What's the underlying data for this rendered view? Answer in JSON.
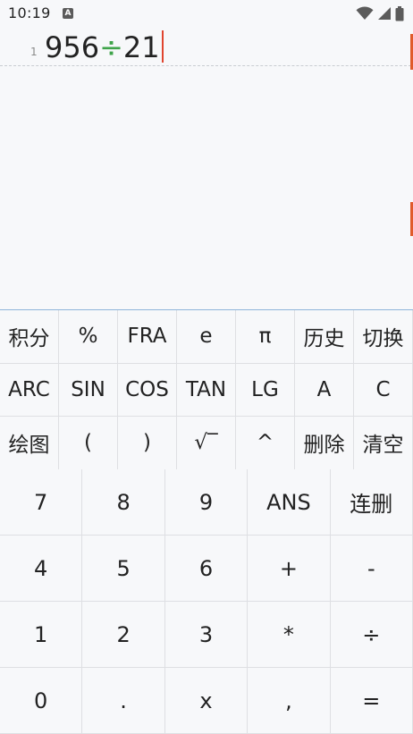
{
  "status_bar": {
    "time": "10:19",
    "notification_icon_letter": "A",
    "icons": [
      "wifi-icon",
      "cellular-signal-icon",
      "battery-icon"
    ]
  },
  "editor": {
    "line_number": "1",
    "expression": {
      "left": "956",
      "operator": "÷",
      "right": "21"
    },
    "cursor_color": "#e0452f",
    "operator_color": "#3fa44a"
  },
  "function_keys": [
    [
      "积分",
      "%",
      "FRA",
      "e",
      "π",
      "历史",
      "切换"
    ],
    [
      "ARC",
      "SIN",
      "COS",
      "TAN",
      "LG",
      "A",
      "C"
    ],
    [
      "绘图",
      "(",
      ")",
      "√‾",
      "^",
      "删除",
      "清空"
    ]
  ],
  "number_keys": [
    [
      "7",
      "8",
      "9",
      "ANS",
      "连删"
    ],
    [
      "4",
      "5",
      "6",
      "+",
      "-"
    ],
    [
      "1",
      "2",
      "3",
      "*",
      "÷"
    ],
    [
      "0",
      ".",
      "x",
      ",",
      "="
    ]
  ],
  "colors": {
    "background": "#f7f8fa",
    "divider": "#dedfe3",
    "keypad_top_border": "#8fb4d9",
    "edge_accent": "#e05a2a"
  }
}
